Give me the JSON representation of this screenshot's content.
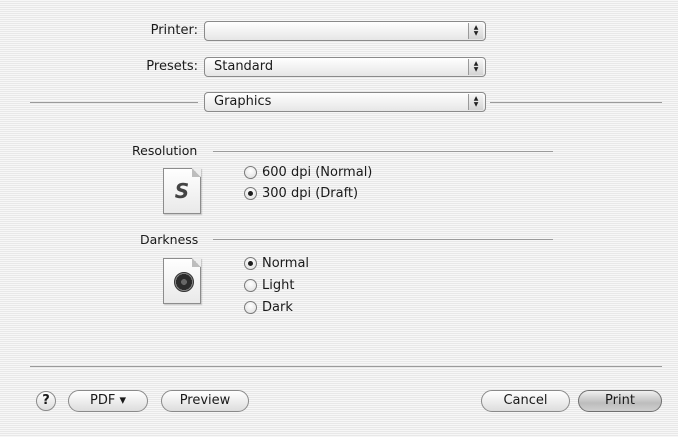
{
  "printer": {
    "label": "Printer:",
    "value": ""
  },
  "presets": {
    "label": "Presets:",
    "value": "Standard"
  },
  "panel": {
    "value": "Graphics"
  },
  "resolution": {
    "label": "Resolution",
    "options": [
      {
        "label": "600 dpi (Normal)",
        "selected": false
      },
      {
        "label": "300 dpi (Draft)",
        "selected": true
      }
    ]
  },
  "darkness": {
    "label": "Darkness",
    "options": [
      {
        "label": "Normal",
        "selected": true
      },
      {
        "label": "Light",
        "selected": false
      },
      {
        "label": "Dark",
        "selected": false
      }
    ]
  },
  "icons": {
    "resolution_glyph": "S"
  },
  "buttons": {
    "help": "?",
    "pdf": "PDF ▾",
    "preview": "Preview",
    "cancel": "Cancel",
    "print": "Print"
  }
}
